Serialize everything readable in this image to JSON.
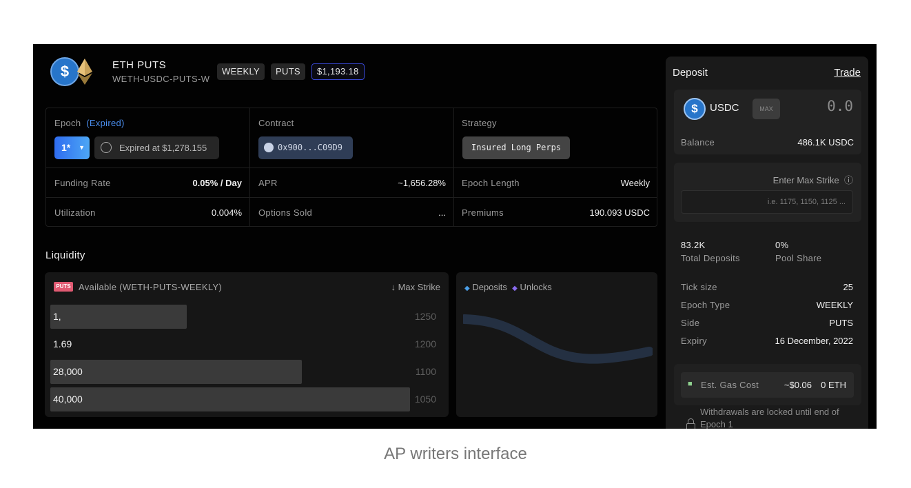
{
  "header": {
    "title": "ETH PUTS",
    "subtitle": "WETH-USDC-PUTS-W",
    "tags": [
      "WEEKLY",
      "PUTS"
    ],
    "price": "$1,193.18"
  },
  "stats": {
    "epoch_label": "Epoch",
    "epoch_status": "(Expired)",
    "epoch_value": "1*",
    "expired_at": "Expired at $1,278.155",
    "contract_label": "Contract",
    "contract_value": "0x900...C09D9",
    "strategy_label": "Strategy",
    "strategy_value": "Insured Long Perps",
    "funding_label": "Funding Rate",
    "funding_value": "0.05% / Day",
    "apr_label": "APR",
    "apr_value": "~1,656.28%",
    "epoch_length_label": "Epoch Length",
    "epoch_length_value": "Weekly",
    "utilization_label": "Utilization",
    "utilization_value": "0.004%",
    "options_sold_label": "Options Sold",
    "options_sold_value": "...",
    "premiums_label": "Premiums",
    "premiums_value": "190.093 USDC"
  },
  "liquidity": {
    "title": "Liquidity",
    "badge": "PUTS",
    "available_label": "Available (WETH-PUTS-WEEKLY)",
    "max_strike_label": "Max Strike",
    "rows": [
      {
        "value": "1,",
        "strike": "1250",
        "fill": 0.38
      },
      {
        "value": "1.69",
        "strike": "1200",
        "fill": 0
      },
      {
        "value": "28,000",
        "strike": "1100",
        "fill": 0.7
      },
      {
        "value": "40,000",
        "strike": "1050",
        "fill": 1.0
      }
    ],
    "legend_deposits": "Deposits",
    "legend_unlocks": "Unlocks"
  },
  "deposit": {
    "title": "Deposit",
    "trade_link": "Trade",
    "token": "USDC",
    "max_label": "MAX",
    "amount": "0.0",
    "balance_label": "Balance",
    "balance_value": "486.1K USDC",
    "enter_max_strike": "Enter Max Strike",
    "strike_placeholder": "i.e. 1175, 1150, 1125 ...",
    "total_deposits_value": "83.2K",
    "total_deposits_label": "Total Deposits",
    "pool_share_value": "0%",
    "pool_share_label": "Pool Share",
    "tick_size_label": "Tick size",
    "tick_size_value": "25",
    "epoch_type_label": "Epoch Type",
    "epoch_type_value": "WEEKLY",
    "side_label": "Side",
    "side_value": "PUTS",
    "expiry_label": "Expiry",
    "expiry_value": "16 December, 2022",
    "gas_label": "Est. Gas Cost",
    "gas_value": "~$0.06",
    "gas_eth": "0 ETH",
    "lock_notice": "Withdrawals are locked until end of Epoch 1"
  },
  "caption": "AP writers interface",
  "colors": {
    "accent": "#2f6cf0",
    "usdc": "#2775ca",
    "puts_badge": "#e05a72"
  }
}
